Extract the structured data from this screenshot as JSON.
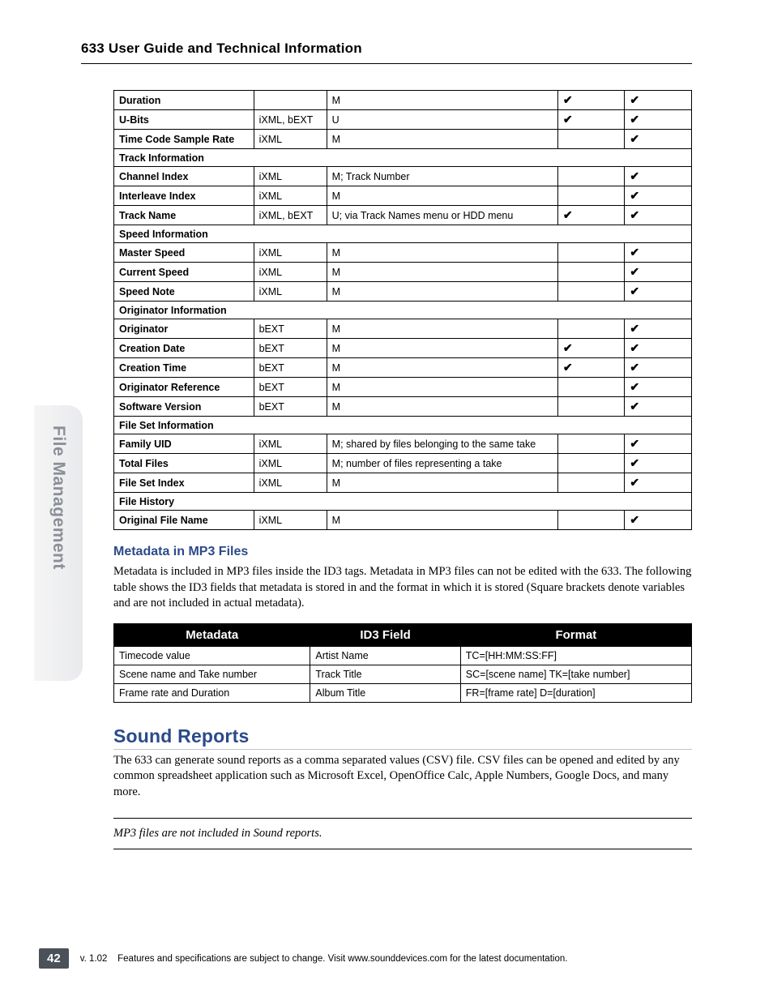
{
  "header": {
    "title": "633 User Guide and Technical Information"
  },
  "sidebar": {
    "label": "File Management"
  },
  "check": "✔",
  "table1": {
    "rows": [
      {
        "type": "data",
        "c1": "Duration",
        "c2": "",
        "c3": "M",
        "c4": true,
        "c5": true
      },
      {
        "type": "data",
        "c1": "U-Bits",
        "c2": "iXML, bEXT",
        "c3": "U",
        "c4": true,
        "c5": true
      },
      {
        "type": "data",
        "c1": "Time Code Sample Rate",
        "c2": "iXML",
        "c3": "M",
        "c4": false,
        "c5": true
      },
      {
        "type": "section",
        "c1": "Track Information"
      },
      {
        "type": "data",
        "c1": "Channel Index",
        "c2": "iXML",
        "c3": "M; Track Number",
        "c4": false,
        "c5": true
      },
      {
        "type": "data",
        "c1": "Interleave Index",
        "c2": "iXML",
        "c3": "M",
        "c4": false,
        "c5": true
      },
      {
        "type": "data",
        "c1": "Track Name",
        "c2": "iXML, bEXT",
        "c3": "U; via Track Names menu or HDD menu",
        "c4": true,
        "c5": true
      },
      {
        "type": "section",
        "c1": "Speed Information"
      },
      {
        "type": "data",
        "c1": "Master Speed",
        "c2": "iXML",
        "c3": "M",
        "c4": false,
        "c5": true
      },
      {
        "type": "data",
        "c1": "Current Speed",
        "c2": "iXML",
        "c3": "M",
        "c4": false,
        "c5": true
      },
      {
        "type": "data",
        "c1": "Speed Note",
        "c2": "iXML",
        "c3": "M",
        "c4": false,
        "c5": true
      },
      {
        "type": "section",
        "c1": "Originator Information"
      },
      {
        "type": "data",
        "c1": "Originator",
        "c2": "bEXT",
        "c3": "M",
        "c4": false,
        "c5": true
      },
      {
        "type": "data",
        "c1": "Creation Date",
        "c2": "bEXT",
        "c3": "M",
        "c4": true,
        "c5": true
      },
      {
        "type": "data",
        "c1": "Creation Time",
        "c2": "bEXT",
        "c3": "M",
        "c4": true,
        "c5": true
      },
      {
        "type": "data",
        "c1": "Originator Reference",
        "c2": "bEXT",
        "c3": "M",
        "c4": false,
        "c5": true
      },
      {
        "type": "data",
        "c1": "Software Version",
        "c2": "bEXT",
        "c3": "M",
        "c4": false,
        "c5": true
      },
      {
        "type": "section",
        "c1": "File Set Information"
      },
      {
        "type": "data",
        "c1": "Family UID",
        "c2": "iXML",
        "c3": "M; shared by files belonging to the same take",
        "c4": false,
        "c5": true
      },
      {
        "type": "data",
        "c1": "Total Files",
        "c2": "iXML",
        "c3": "M; number of files representing a take",
        "c4": false,
        "c5": true
      },
      {
        "type": "data",
        "c1": "File Set Index",
        "c2": "iXML",
        "c3": "M",
        "c4": false,
        "c5": true
      },
      {
        "type": "section",
        "c1": "File History"
      },
      {
        "type": "data",
        "c1": "Original File Name",
        "c2": "iXML",
        "c3": "M",
        "c4": false,
        "c5": true
      }
    ]
  },
  "mp3": {
    "heading": "Metadata in MP3 Files",
    "para": "Metadata is included in MP3 files inside the ID3 tags. Metadata in MP3 files can not be edited with the 633. The following table shows the ID3 fields that metadata is stored in and the format in which it is stored (Square brackets denote variables and are not included in actual metadata)."
  },
  "table2": {
    "headers": [
      "Metadata",
      "ID3 Field",
      "Format"
    ],
    "rows": [
      {
        "c1": "Timecode value",
        "c2": "Artist Name",
        "c3": "TC=[HH:MM:SS:FF]"
      },
      {
        "c1": "Scene name and Take number",
        "c2": "Track Title",
        "c3": "SC=[scene name] TK=[take number]"
      },
      {
        "c1": "Frame rate and Duration",
        "c2": "Album Title",
        "c3": "FR=[frame rate] D=[duration]"
      }
    ]
  },
  "sound": {
    "heading": "Sound Reports",
    "para": "The 633 can generate sound reports as a comma separated values (CSV) file. CSV files can be opened and edited by any common spreadsheet application such as Microsoft Excel, OpenOffice Calc, Apple Numbers, Google Docs, and many more.",
    "note": "MP3 files are not included in Sound reports."
  },
  "footer": {
    "page": "42",
    "version": "v. 1.02",
    "text": "Features and specifications are subject to change. Visit www.sounddevices.com for the latest documentation."
  }
}
